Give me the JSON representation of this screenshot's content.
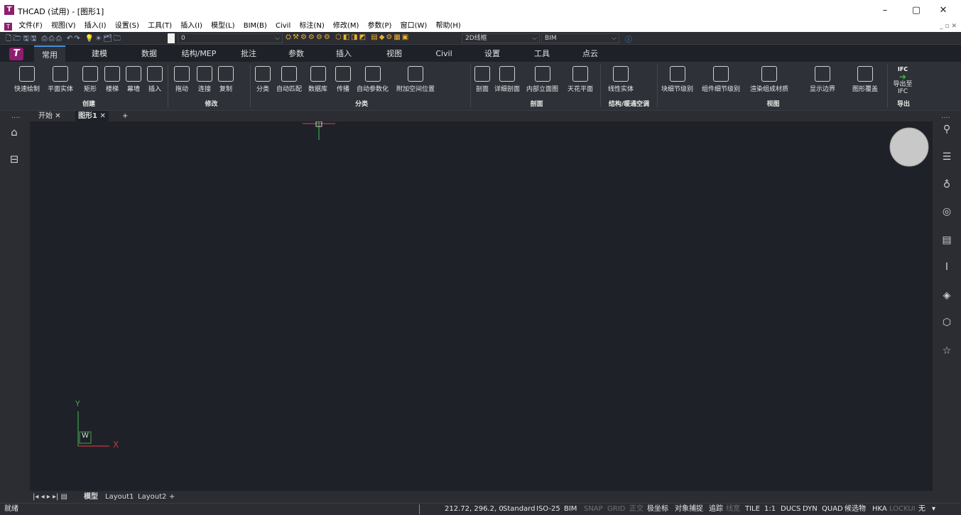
{
  "window": {
    "title": "THCAD (试用) - [图形1]",
    "app_icon": "T",
    "minimize": "–",
    "restore": "▢",
    "close": "✕"
  },
  "menu": {
    "items": [
      "文件(F)",
      "视图(V)",
      "插入(I)",
      "设置(S)",
      "工具(T)",
      "插入(I)",
      "模型(L)",
      "BIM(B)",
      "Civil",
      "标注(N)",
      "修改(M)",
      "参数(P)",
      "窗口(W)",
      "帮助(H)"
    ],
    "tail": "_ ▫ ✕"
  },
  "quick_access": {
    "layer_value": "0",
    "visual_style": "2D线框",
    "workspace": "BIM"
  },
  "ribbon_tabs": [
    "常用",
    "建模",
    "数据",
    "结构/MEP",
    "批注",
    "参数",
    "插入",
    "视图",
    "Civil",
    "设置",
    "工具",
    "点云"
  ],
  "ribbon": {
    "create": {
      "label": "创建",
      "buttons": [
        "快速绘制",
        "平面实体",
        "矩形",
        "楼梯",
        "幕墙",
        "插入"
      ]
    },
    "modify": {
      "label": "修改",
      "buttons": [
        "拖动",
        "连接",
        "复制"
      ]
    },
    "classify": {
      "label": "分类",
      "buttons": [
        "分类",
        "自动匹配",
        "数据库",
        "传播",
        "自动参数化",
        "附加空间位置"
      ]
    },
    "section": {
      "label": "剖面",
      "buttons": [
        "剖面",
        "详细剖面",
        "内部立面图",
        "天花平面"
      ]
    },
    "hvac": {
      "label": "结构/暖通空调",
      "buttons": [
        "线性实体"
      ]
    },
    "view": {
      "label": "视图",
      "buttons": [
        "块细节级别",
        "组件细节级别",
        "渲染组成材质",
        "显示边界",
        "图形覆盖"
      ]
    },
    "export": {
      "label": "导出",
      "button": "导出至 IFC",
      "badge": "IFC"
    }
  },
  "doc_tabs": {
    "dots": "....",
    "start": "开始",
    "drawing": "图形1",
    "add": "+"
  },
  "ucs": {
    "x": "X",
    "y": "Y",
    "w": "W"
  },
  "layout_tabs": {
    "model": "模型",
    "layout1": "Layout1",
    "layout2": "Layout2",
    "add": "+"
  },
  "status": {
    "ready": "就绪",
    "coords": "212.72, 296.2, 0",
    "items": [
      {
        "label": "Standard",
        "on": true
      },
      {
        "label": "ISO-25",
        "on": true
      },
      {
        "label": "BIM",
        "on": true
      },
      {
        "label": "SNAP",
        "on": false
      },
      {
        "label": "GRID",
        "on": false
      },
      {
        "label": "正交",
        "on": false
      },
      {
        "label": "极坐标",
        "on": true
      },
      {
        "label": "对象捕捉",
        "on": true
      },
      {
        "label": "追踪",
        "on": true
      },
      {
        "label": "线宽",
        "on": false
      },
      {
        "label": "TILE",
        "on": true
      },
      {
        "label": "1:1",
        "on": true
      },
      {
        "label": "DUCS",
        "on": true
      },
      {
        "label": "DYN",
        "on": true
      },
      {
        "label": "QUAD",
        "on": true
      },
      {
        "label": "候选物",
        "on": true
      },
      {
        "label": "HKA",
        "on": true
      },
      {
        "label": "LOCKUI",
        "on": false
      },
      {
        "label": "无",
        "on": true
      }
    ]
  },
  "colors": {
    "accent": "#8e1e6e",
    "canvas": "#1e2128",
    "panel": "#2b2d33",
    "ribbon": "#2e3138"
  }
}
